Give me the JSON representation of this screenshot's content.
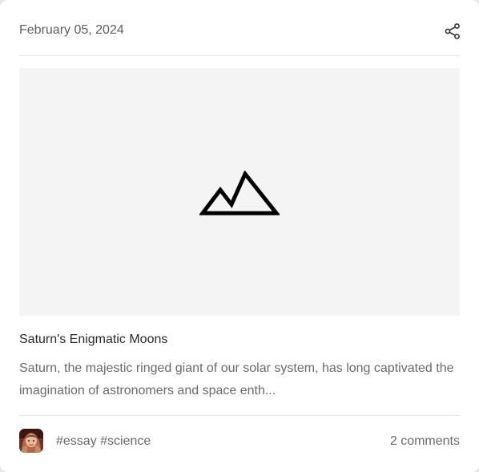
{
  "post": {
    "date": "February 05, 2024",
    "title": "Saturn's Enigmatic Moons",
    "excerpt": "Saturn, the majestic ringed giant of our solar system, has long captivated the imagination of astronomers and space enth...",
    "tags": [
      "#essay",
      "#science"
    ],
    "comments_text": "2 comments"
  },
  "icons": {
    "share": "share-icon",
    "image_placeholder": "mountain-image-icon",
    "avatar": "user-avatar"
  },
  "colors": {
    "card_bg": "#ffffff",
    "media_bg": "#f4f4f4",
    "divider": "#e4e4e4",
    "text_muted": "#6b6b6b",
    "text_title": "#2b2b2b"
  }
}
